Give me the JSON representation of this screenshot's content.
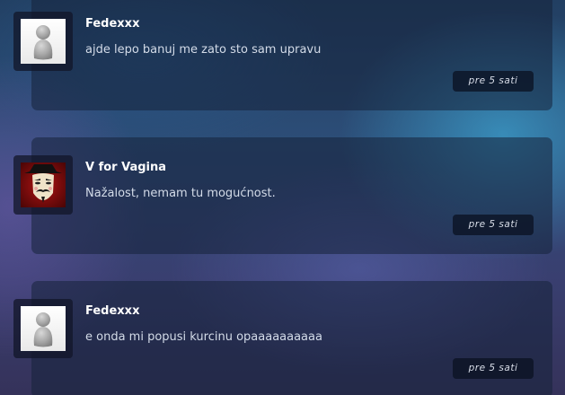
{
  "comments": [
    {
      "author": "Fedexxx",
      "message": "ajde lepo banuj me zato sto sam upravu",
      "time": "pre 5 sati",
      "avatar": "default-user-avatar"
    },
    {
      "author": "V for Vagina",
      "message": "Nažalost, nemam tu mogućnost.",
      "time": "pre 5 sati",
      "avatar": "guy-fawkes-mask-avatar"
    },
    {
      "author": "Fedexxx",
      "message": "e onda mi popusi kurcinu opaaaaaaaaaa",
      "time": "pre 5 sati",
      "avatar": "default-user-avatar"
    }
  ],
  "colors": {
    "card_background": "#16223a",
    "author_text": "#ffffff",
    "message_text": "#d3dbe8",
    "time_badge_background": "#0a1222"
  }
}
